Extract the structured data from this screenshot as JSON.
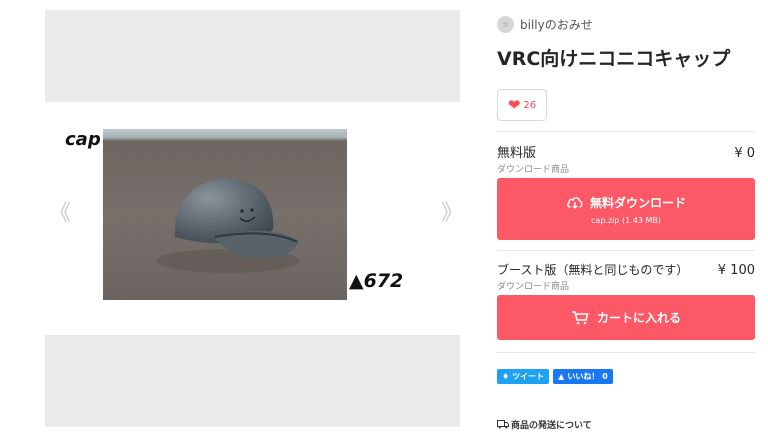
{
  "gallery": {
    "image_overlay_left": "cap",
    "image_overlay_right": "▲672",
    "prev_arrow": "《",
    "next_arrow": "》"
  },
  "shop": {
    "name": "billyのおみせ",
    "avatar_icon": "shop-avatar-icon"
  },
  "product": {
    "title": "VRC向けニコニコキャップ"
  },
  "likes": {
    "count": "26",
    "icon": "heart-icon"
  },
  "variants": [
    {
      "name": "無料版",
      "type": "ダウンロード商品",
      "price": "¥ 0",
      "button_label": "無料ダウンロード",
      "button_sub": "cap.zip (1.43 MB)",
      "button_icon": "cloud-download-icon"
    },
    {
      "name": "ブースト版（無料と同じものです）",
      "type": "ダウンロード商品",
      "price": "¥ 100",
      "button_label": "カートに入れる",
      "button_icon": "cart-icon"
    }
  ],
  "social": {
    "tweet_label": "ツイート",
    "like_label": "いいね！ 0"
  },
  "shipping": {
    "label": "商品の発送について",
    "icon": "truck-icon"
  },
  "colors": {
    "accent": "#fc5865",
    "heart": "#fc4d50",
    "twitter": "#1da1f2",
    "facebook": "#1877f2"
  }
}
